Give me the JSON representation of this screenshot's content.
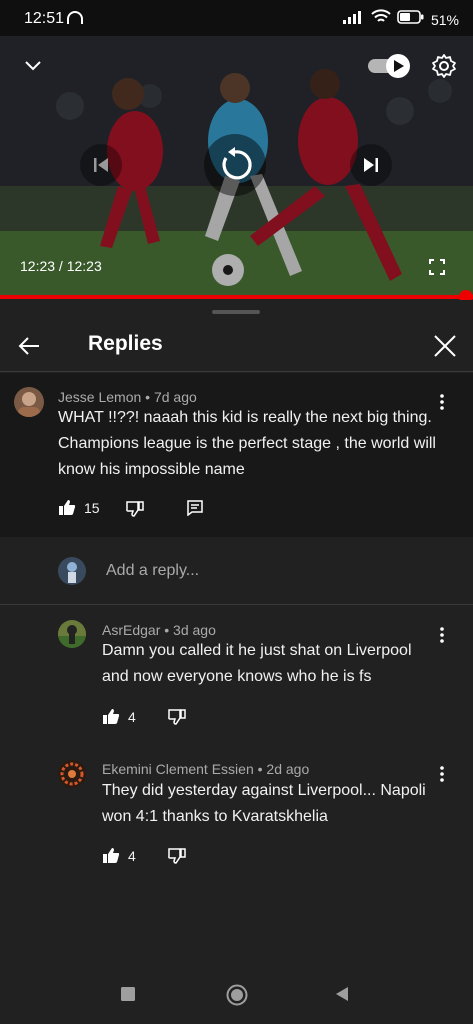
{
  "status": {
    "time": "12:51",
    "battery": "51%"
  },
  "video": {
    "time": "12:23 / 12:23"
  },
  "panel": {
    "title": "Replies"
  },
  "comment": {
    "author": "Jesse Lemon",
    "age": "7d ago",
    "text": "WHAT !!??! naaah this kid is really the next big thing. Champions league is the perfect stage , the world will know his impossible name",
    "likes": "15"
  },
  "add_reply": {
    "placeholder": "Add a reply..."
  },
  "replies": [
    {
      "author": "AsrEdgar",
      "age": "3d ago",
      "text": "Damn you called it he just shat on Liverpool and now everyone knows who he is fs",
      "likes": "4"
    },
    {
      "author": "Ekemini Clement Essien",
      "age": "2d ago",
      "text": "They did yesterday against Liverpool... Napoli won 4:1 thanks to Kvaratskhelia",
      "likes": "4"
    }
  ],
  "icons": {
    "network": "signal-icon",
    "wifi": "wifi-icon",
    "battery": "battery-icon",
    "collapse": "chevron-down-icon",
    "autoplay": "autoplay-toggle",
    "settings": "gear-icon",
    "prev": "skip-previous-icon",
    "replay": "replay-icon",
    "next": "skip-next-icon",
    "fullscreen": "fullscreen-icon",
    "back": "back-arrow-icon",
    "close": "close-icon",
    "more": "more-vert-icon",
    "like": "thumb-up-icon",
    "dislike": "thumb-down-icon",
    "reply": "comment-icon"
  },
  "colors": {
    "progress": "#ee0000",
    "background": "#212121",
    "comment_bg": "#181818"
  },
  "video_progress": 1.0
}
